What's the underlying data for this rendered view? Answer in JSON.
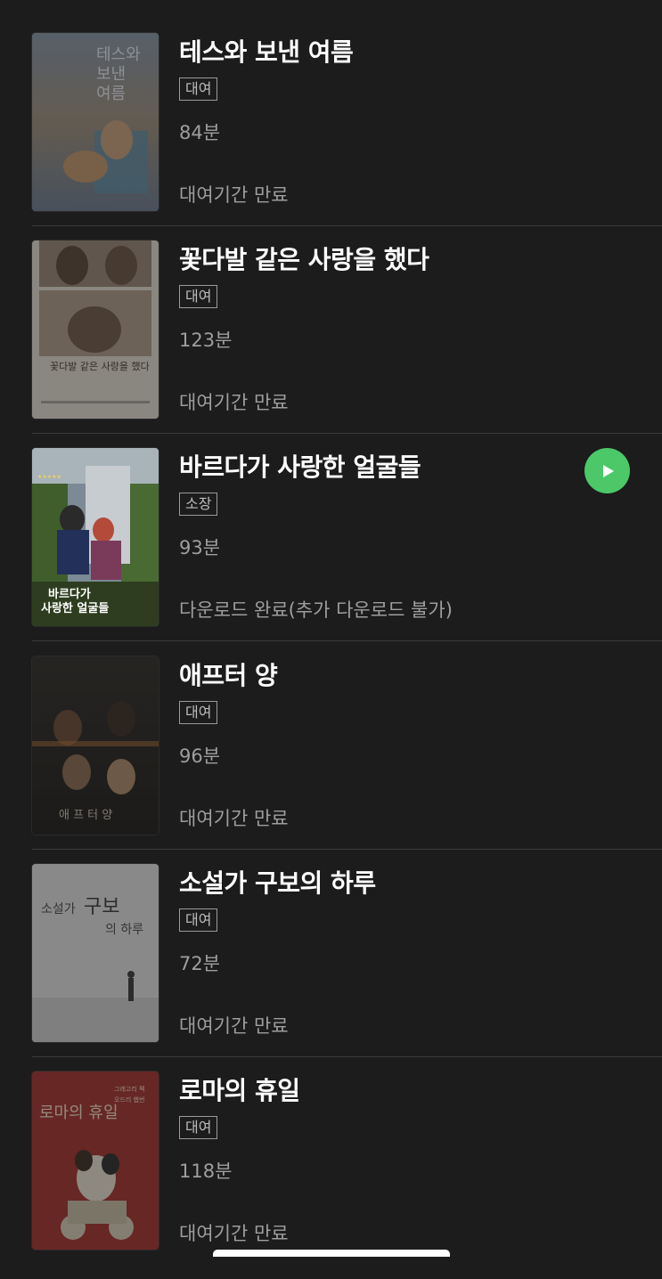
{
  "items": [
    {
      "title": "테스와 보낸 여름",
      "badge": "대여",
      "duration": "84분",
      "status": "대여기간 만료",
      "poster_text": "테스와 보낸 여름",
      "poster_colors": [
        "#6b7e96",
        "#a58a6a",
        "#5a6f86"
      ]
    },
    {
      "title": "꽃다발 같은 사랑을 했다",
      "badge": "대여",
      "duration": "123분",
      "status": "대여기간 만료",
      "poster_text": "꽃다발 같은 사랑을 했다",
      "poster_colors": [
        "#d9d2c6",
        "#8a6f5c",
        "#b9a999"
      ]
    },
    {
      "title": "바르다가 사랑한 얼굴들",
      "badge": "소장",
      "duration": "93분",
      "status": "다운로드 완료(추가 다운로드 불가)",
      "poster_text": "바르다가 사랑한 얼굴들",
      "poster_colors": [
        "#3d5a2a",
        "#9aa3a8",
        "#2a3a6a"
      ],
      "play_button": "play-icon"
    },
    {
      "title": "애프터 양",
      "badge": "대여",
      "duration": "96분",
      "status": "대여기간 만료",
      "poster_text": "애 프 터 양",
      "poster_colors": [
        "#2e2a24",
        "#6a4a34",
        "#b5784a"
      ]
    },
    {
      "title": "소설가 구보의 하루",
      "badge": "대여",
      "duration": "72분",
      "status": "대여기간 만료",
      "poster_text": "소설가 구보의 하루",
      "poster_colors": [
        "#e6e6e6",
        "#9a9a9a",
        "#cfcfcf"
      ]
    },
    {
      "title": "로마의 휴일",
      "badge": "대여",
      "duration": "118분",
      "status": "대여기간 만료",
      "poster_text": "로마의 휴일",
      "poster_colors": [
        "#a02a26",
        "#e4d7c2",
        "#6a1512"
      ]
    }
  ]
}
